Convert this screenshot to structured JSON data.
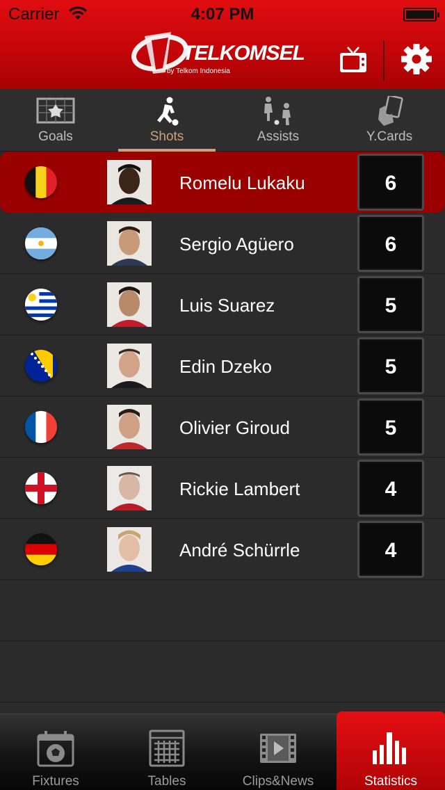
{
  "status_bar": {
    "carrier": "Carrier",
    "time": "4:07 PM"
  },
  "header": {
    "logo_text": "TELKOMSEL",
    "logo_subtext": "by Telkom Indonesia",
    "tv_icon": "tv-icon",
    "settings_icon": "gear-icon"
  },
  "category_tabs": [
    {
      "label": "Goals",
      "icon": "goal-net-icon",
      "active": false
    },
    {
      "label": "Shots",
      "icon": "kicking-player-icon",
      "active": true
    },
    {
      "label": "Assists",
      "icon": "passing-players-icon",
      "active": false
    },
    {
      "label": "Y.Cards",
      "icon": "card-in-hand-icon",
      "active": false
    }
  ],
  "players": [
    {
      "name": "Romelu Lukaku",
      "value": "6",
      "country": "Belgium",
      "highlighted": true
    },
    {
      "name": "Sergio Agüero",
      "value": "6",
      "country": "Argentina",
      "highlighted": false
    },
    {
      "name": "Luis Suarez",
      "value": "5",
      "country": "Uruguay",
      "highlighted": false
    },
    {
      "name": "Edin Dzeko",
      "value": "5",
      "country": "Bosnia and Herzegovina",
      "highlighted": false
    },
    {
      "name": "Olivier Giroud",
      "value": "5",
      "country": "France",
      "highlighted": false
    },
    {
      "name": "Rickie Lambert",
      "value": "4",
      "country": "England",
      "highlighted": false
    },
    {
      "name": "André Schürrle",
      "value": "4",
      "country": "Germany",
      "highlighted": false
    }
  ],
  "bottom_tabs": [
    {
      "label": "Fixtures",
      "icon": "calendar-ball-icon",
      "active": false
    },
    {
      "label": "Tables",
      "icon": "grid-table-icon",
      "active": false
    },
    {
      "label": "Clips&News",
      "icon": "film-play-icon",
      "active": false
    },
    {
      "label": "Statistics",
      "icon": "bar-chart-icon",
      "active": true
    }
  ],
  "colors": {
    "brand_red": "#d00a0c",
    "highlight_row": "#9a0000",
    "active_tab_text": "#c8a27a"
  }
}
